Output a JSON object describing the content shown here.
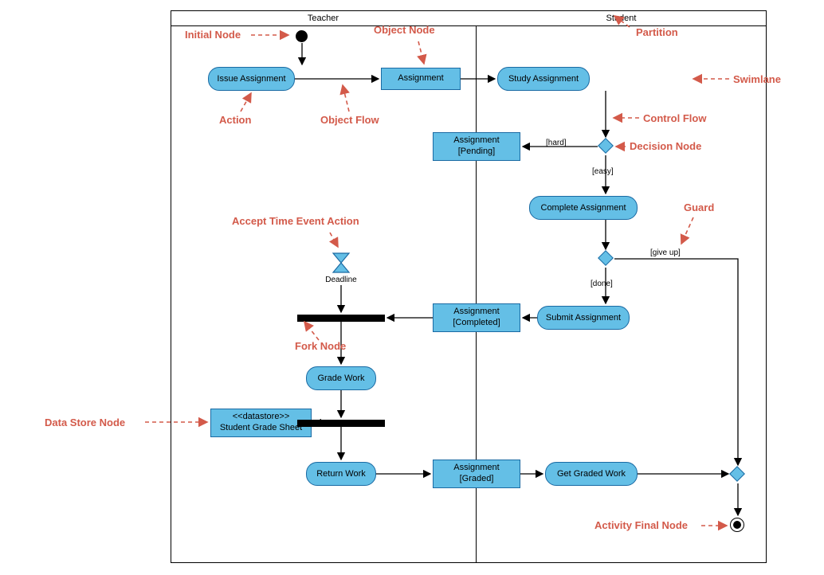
{
  "lanes": {
    "teacher": "Teacher",
    "student": "Student"
  },
  "nodes": {
    "issue_assignment": "Issue Assignment",
    "assignment": "Assignment",
    "study_assignment": "Study Assignment",
    "assignment_pending": "Assignment",
    "assignment_pending_state": "[Pending]",
    "complete_assignment": "Complete Assignment",
    "submit_assignment": "Submit Assignment",
    "assignment_completed": "Assignment",
    "assignment_completed_state": "[Completed]",
    "grade_work": "Grade Work",
    "datastore_stereo": "<<datastore>>",
    "datastore_name": "Student Grade Sheet",
    "return_work": "Return Work",
    "assignment_graded": "Assignment",
    "assignment_graded_state": "[Graded]",
    "get_graded_work": "Get Graded Work",
    "deadline": "Deadline"
  },
  "guards": {
    "hard": "[hard]",
    "easy": "[easy]",
    "done": "[done]",
    "giveup": "[give up]"
  },
  "annotations": {
    "initial_node": "Initial Node",
    "object_node": "Object Node",
    "partition": "Partition",
    "swimlane": "Swimlane",
    "action": "Action",
    "object_flow": "Object Flow",
    "control_flow": "Control Flow",
    "decision_node": "Decision Node",
    "accept_time": "Accept Time Event Action",
    "fork_node": "Fork Node",
    "guard": "Guard",
    "data_store_node": "Data Store Node",
    "activity_final_node": "Activity Final Node"
  },
  "chart_data": {
    "type": "uml-activity-diagram",
    "partitions": [
      "Teacher",
      "Student"
    ],
    "nodes": [
      {
        "id": "initial",
        "type": "initial",
        "partition": "Teacher"
      },
      {
        "id": "issue",
        "type": "action",
        "label": "Issue Assignment",
        "partition": "Teacher"
      },
      {
        "id": "obj_assign",
        "type": "object",
        "label": "Assignment",
        "partition": "Teacher"
      },
      {
        "id": "study",
        "type": "action",
        "label": "Study Assignment",
        "partition": "Student"
      },
      {
        "id": "dec1",
        "type": "decision",
        "partition": "Student"
      },
      {
        "id": "obj_pending",
        "type": "object",
        "label": "Assignment",
        "state": "Pending",
        "partition": "Teacher"
      },
      {
        "id": "complete",
        "type": "action",
        "label": "Complete Assignment",
        "partition": "Student"
      },
      {
        "id": "dec2",
        "type": "decision",
        "partition": "Student"
      },
      {
        "id": "submit",
        "type": "action",
        "label": "Submit Assignment",
        "partition": "Student"
      },
      {
        "id": "obj_completed",
        "type": "object",
        "label": "Assignment",
        "state": "Completed",
        "partition": "Teacher"
      },
      {
        "id": "time",
        "type": "accept-time-event",
        "label": "Deadline",
        "partition": "Teacher"
      },
      {
        "id": "fork1",
        "type": "fork",
        "partition": "Teacher"
      },
      {
        "id": "grade",
        "type": "action",
        "label": "Grade Work",
        "partition": "Teacher"
      },
      {
        "id": "fork2",
        "type": "fork",
        "partition": "Teacher"
      },
      {
        "id": "datastore",
        "type": "datastore",
        "label": "Student Grade Sheet",
        "partition": "Teacher"
      },
      {
        "id": "return",
        "type": "action",
        "label": "Return Work",
        "partition": "Teacher"
      },
      {
        "id": "obj_graded",
        "type": "object",
        "label": "Assignment",
        "state": "Graded",
        "partition": "Teacher"
      },
      {
        "id": "getgraded",
        "type": "action",
        "label": "Get Graded Work",
        "partition": "Student"
      },
      {
        "id": "merge",
        "type": "merge",
        "partition": "Student"
      },
      {
        "id": "final",
        "type": "final",
        "partition": "Student"
      }
    ],
    "edges": [
      {
        "from": "initial",
        "to": "issue"
      },
      {
        "from": "issue",
        "to": "obj_assign",
        "type": "object-flow"
      },
      {
        "from": "obj_assign",
        "to": "study",
        "type": "object-flow"
      },
      {
        "from": "study",
        "to": "dec1",
        "type": "control-flow"
      },
      {
        "from": "dec1",
        "to": "obj_pending",
        "guard": "hard"
      },
      {
        "from": "dec1",
        "to": "complete",
        "guard": "easy"
      },
      {
        "from": "complete",
        "to": "dec2"
      },
      {
        "from": "dec2",
        "to": "submit",
        "guard": "done"
      },
      {
        "from": "dec2",
        "to": "merge",
        "guard": "give up"
      },
      {
        "from": "submit",
        "to": "obj_completed",
        "type": "object-flow"
      },
      {
        "from": "time",
        "to": "fork1"
      },
      {
        "from": "obj_completed",
        "to": "fork1"
      },
      {
        "from": "fork1",
        "to": "grade"
      },
      {
        "from": "grade",
        "to": "fork2"
      },
      {
        "from": "fork2",
        "to": "datastore"
      },
      {
        "from": "fork2",
        "to": "return"
      },
      {
        "from": "return",
        "to": "obj_graded",
        "type": "object-flow"
      },
      {
        "from": "obj_graded",
        "to": "getgraded",
        "type": "object-flow"
      },
      {
        "from": "getgraded",
        "to": "merge"
      },
      {
        "from": "merge",
        "to": "final"
      }
    ]
  }
}
